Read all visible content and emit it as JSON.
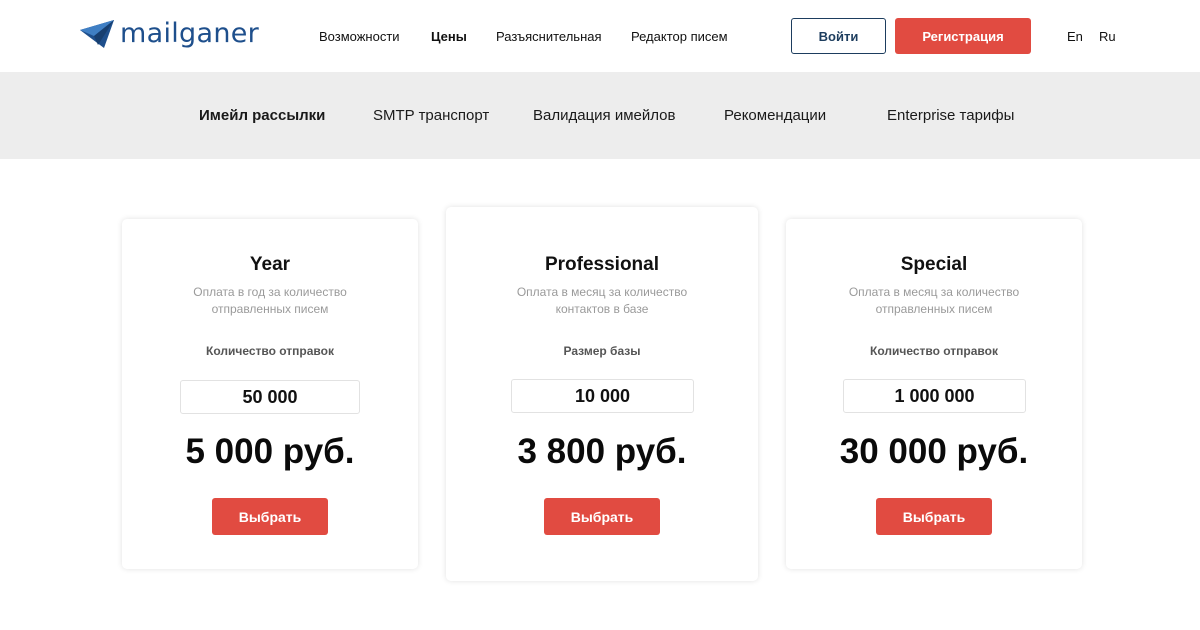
{
  "brand": {
    "name": "mailganer",
    "color": "#1e4f8c"
  },
  "nav": {
    "items": [
      "Возможности",
      "Цены",
      "Разъяснительная",
      "Редактор писем"
    ],
    "active": "Цены"
  },
  "auth": {
    "login_label": "Войти",
    "register_label": "Регистрация",
    "accent": "#e14b41"
  },
  "languages": [
    "En",
    "Ru"
  ],
  "subnav": {
    "items": [
      "Имейл рассылки",
      "SMTP транспорт",
      "Валидация имейлов",
      "Рекомендации",
      "Enterprise тарифы"
    ],
    "active": "Имейл рассылки"
  },
  "plans": [
    {
      "title": "Year",
      "desc_lines": [
        "Оплата в год за количество",
        "отправленных писем"
      ],
      "label": "Количество отправок",
      "amount": "50 000",
      "price": "5 000 руб.",
      "button": "Выбрать"
    },
    {
      "title": "Professional",
      "desc_lines": [
        "Оплата в месяц за количество",
        "контактов в базе"
      ],
      "label": "Размер базы",
      "amount": "10 000",
      "price": "3 800 руб.",
      "button": "Выбрать"
    },
    {
      "title": "Special",
      "desc_lines": [
        "Оплата в месяц за количество",
        "отправленных писем"
      ],
      "label": "Количество отправок",
      "amount": "1 000 000",
      "price": "30 000 руб.",
      "button": "Выбрать"
    }
  ]
}
